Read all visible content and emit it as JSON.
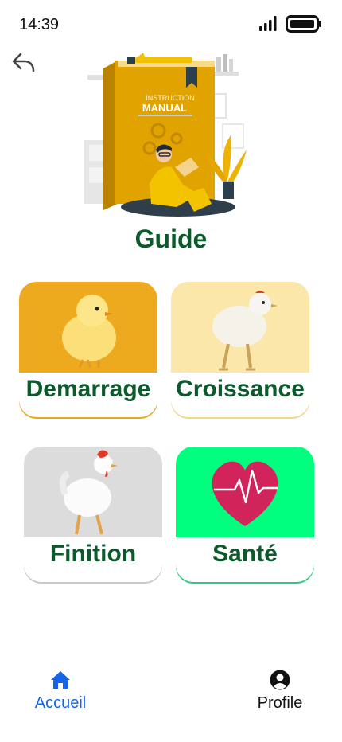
{
  "status_bar": {
    "time": "14:39"
  },
  "header": {
    "back_icon": "undo-arrow-icon"
  },
  "hero": {
    "illustration": "instruction-manual-illustration",
    "book_line1": "INSTRUCTION",
    "book_line2": "MANUAL"
  },
  "title": "Guide",
  "cards": [
    {
      "label": "Demarrage",
      "image": "chick-image",
      "color": "#eeaa1f"
    },
    {
      "label": "Croissance",
      "image": "white-chicken-image",
      "color": "#fbe7a9"
    },
    {
      "label": "Finition",
      "image": "rooster-image",
      "color": "#dcdcdc"
    },
    {
      "label": "Santé",
      "image": "heart-pulse-image",
      "color": "#00ff7e"
    }
  ],
  "bottom_nav": {
    "home": {
      "label": "Accueil",
      "icon": "home-icon",
      "color": "#1565e6"
    },
    "profile": {
      "label": "Profile",
      "icon": "user-circle-icon"
    }
  }
}
